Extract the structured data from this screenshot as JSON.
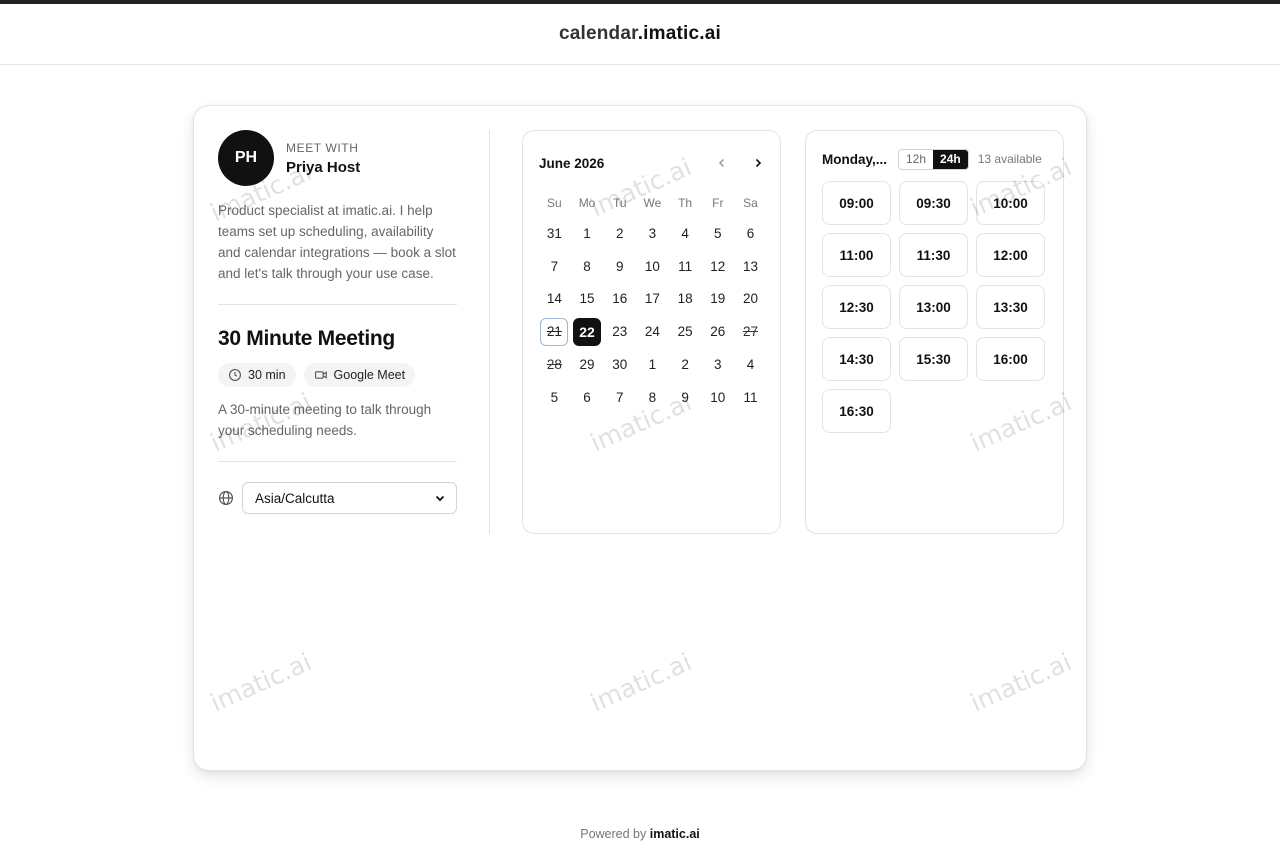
{
  "site": {
    "title_part1": "calendar",
    "title_part2": ".imatic.ai"
  },
  "host": {
    "initials": "PH",
    "meet_with_label": "MEET WITH",
    "name": "Priya Host",
    "bio": "Product specialist at imatic.ai. I help teams set up scheduling, availability and calendar integrations — book a slot and let's talk through your use case."
  },
  "event": {
    "title": "30 Minute Meeting",
    "duration": "30 min",
    "location": "Google Meet",
    "description": "A 30-minute meeting to talk through your scheduling needs."
  },
  "timezone": {
    "value": "Asia/Calcutta"
  },
  "calendar": {
    "month_label": "June 2026",
    "weekdays": [
      "Su",
      "Mo",
      "Tu",
      "We",
      "Th",
      "Fr",
      "Sa"
    ],
    "days": [
      {
        "d": "31",
        "state": "normal"
      },
      {
        "d": "1",
        "state": "normal"
      },
      {
        "d": "2",
        "state": "normal"
      },
      {
        "d": "3",
        "state": "normal"
      },
      {
        "d": "4",
        "state": "normal"
      },
      {
        "d": "5",
        "state": "normal"
      },
      {
        "d": "6",
        "state": "normal"
      },
      {
        "d": "7",
        "state": "normal"
      },
      {
        "d": "8",
        "state": "normal"
      },
      {
        "d": "9",
        "state": "normal"
      },
      {
        "d": "10",
        "state": "normal"
      },
      {
        "d": "11",
        "state": "normal"
      },
      {
        "d": "12",
        "state": "normal"
      },
      {
        "d": "13",
        "state": "normal"
      },
      {
        "d": "14",
        "state": "normal"
      },
      {
        "d": "15",
        "state": "normal"
      },
      {
        "d": "16",
        "state": "normal"
      },
      {
        "d": "17",
        "state": "normal"
      },
      {
        "d": "18",
        "state": "normal"
      },
      {
        "d": "19",
        "state": "normal"
      },
      {
        "d": "20",
        "state": "normal"
      },
      {
        "d": "21",
        "state": "today"
      },
      {
        "d": "22",
        "state": "selected"
      },
      {
        "d": "23",
        "state": "normal"
      },
      {
        "d": "24",
        "state": "normal"
      },
      {
        "d": "25",
        "state": "normal"
      },
      {
        "d": "26",
        "state": "normal"
      },
      {
        "d": "27",
        "state": "off"
      },
      {
        "d": "28",
        "state": "off"
      },
      {
        "d": "29",
        "state": "normal"
      },
      {
        "d": "30",
        "state": "normal"
      },
      {
        "d": "1",
        "state": "normal"
      },
      {
        "d": "2",
        "state": "normal"
      },
      {
        "d": "3",
        "state": "normal"
      },
      {
        "d": "4",
        "state": "normal"
      },
      {
        "d": "5",
        "state": "normal"
      },
      {
        "d": "6",
        "state": "normal"
      },
      {
        "d": "7",
        "state": "normal"
      },
      {
        "d": "8",
        "state": "normal"
      },
      {
        "d": "9",
        "state": "normal"
      },
      {
        "d": "10",
        "state": "normal"
      },
      {
        "d": "11",
        "state": "normal"
      }
    ]
  },
  "slots": {
    "date_label": "Monday,...",
    "format_12h": "12h",
    "format_24h": "24h",
    "active_format": "24h",
    "available_label": "13 available",
    "times": [
      "09:00",
      "09:30",
      "10:00",
      "11:00",
      "11:30",
      "12:00",
      "12:30",
      "13:00",
      "13:30",
      "14:30",
      "15:30",
      "16:00",
      "16:30"
    ]
  },
  "watermark": "imatic.ai",
  "footer": {
    "prefix": "Powered by",
    "brand": "imatic.ai"
  },
  "colors": {
    "accent": "#111111",
    "today_ring": "#9fb6d6",
    "muted_text": "#666666"
  },
  "icons": {
    "duration": "clock-icon",
    "location": "video-icon",
    "timezone": "globe-icon",
    "prev": "chevron-left-icon",
    "next": "chevron-right-icon",
    "select": "chevron-down-icon"
  }
}
